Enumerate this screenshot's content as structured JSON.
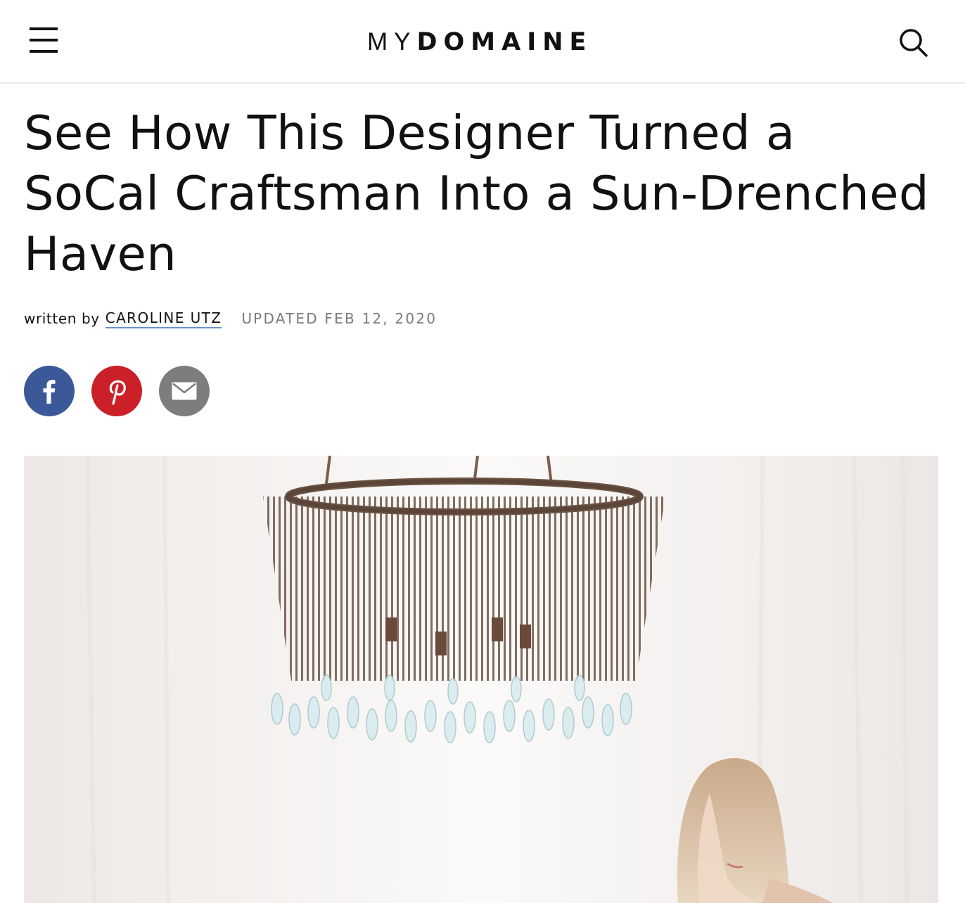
{
  "header": {
    "menu_icon": "hamburger-menu-icon",
    "logo_part1": "MY",
    "logo_part2": "DOMAINE",
    "search_icon": "search-icon"
  },
  "article": {
    "title": "See How This Designer Turned a SoCal Craftsman Into a Sun-Drenched Haven",
    "written_by": "written by",
    "author": "CAROLINE UTZ",
    "updated": "UPDATED FEB 12, 2020"
  },
  "share": {
    "facebook_icon": "facebook-icon",
    "pinterest_icon": "pinterest-icon",
    "email_icon": "email-icon",
    "colors": {
      "facebook": "#3b5998",
      "pinterest": "#cb2027",
      "email": "#7d7d7d"
    }
  },
  "hero": {
    "image_subject": "chandelier-with-woman-photo"
  }
}
